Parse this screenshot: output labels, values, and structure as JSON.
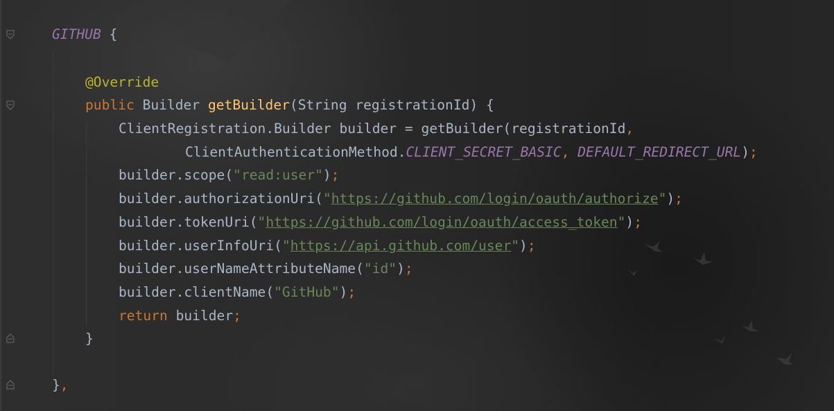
{
  "editor": {
    "lines": [
      {
        "id": "l1",
        "parts": [
          "GITHUB",
          " {"
        ]
      },
      {
        "id": "l3",
        "parts": [
          "@Override"
        ]
      },
      {
        "id": "l4",
        "parts": [
          "public",
          " Builder ",
          "getBuilder",
          "(String registrationId) {"
        ]
      },
      {
        "id": "l5",
        "parts": [
          "ClientRegistration.Builder builder = getBuilder(registrationId",
          ","
        ]
      },
      {
        "id": "l6",
        "parts": [
          "ClientAuthenticationMethod.",
          "CLIENT_SECRET_BASIC",
          ", ",
          "DEFAULT_REDIRECT_URL",
          ")",
          ";"
        ]
      },
      {
        "id": "l7",
        "parts": [
          "builder.scope(",
          "\"read:user\"",
          ")",
          ";"
        ]
      },
      {
        "id": "l8",
        "parts": [
          "builder.authorizationUri(",
          "\"",
          "https://github.com/login/oauth/authorize",
          "\"",
          ")",
          ";"
        ]
      },
      {
        "id": "l9",
        "parts": [
          "builder.tokenUri(",
          "\"",
          "https://github.com/login/oauth/access_token",
          "\"",
          ")",
          ";"
        ]
      },
      {
        "id": "l10",
        "parts": [
          "builder.userInfoUri(",
          "\"",
          "https://api.github.com/user",
          "\"",
          ")",
          ";"
        ]
      },
      {
        "id": "l11",
        "parts": [
          "builder.userNameAttributeName(",
          "\"id\"",
          ")",
          ";"
        ]
      },
      {
        "id": "l12",
        "parts": [
          "builder.clientName(",
          "\"GitHub\"",
          ")",
          ";"
        ]
      },
      {
        "id": "l13",
        "parts": [
          "return",
          " builder",
          ";"
        ]
      },
      {
        "id": "l14",
        "parts": [
          "}"
        ]
      },
      {
        "id": "l16",
        "parts": [
          "}",
          ","
        ]
      }
    ]
  },
  "theme": {
    "keyword": "#cc7832",
    "enum_constant": "#9876aa",
    "annotation": "#bbb529",
    "method": "#ffc66d",
    "string": "#6a8759",
    "text": "#a9b7c6"
  },
  "icons": {
    "fold": "fold-marker-icon",
    "birds": "bird-icon"
  }
}
